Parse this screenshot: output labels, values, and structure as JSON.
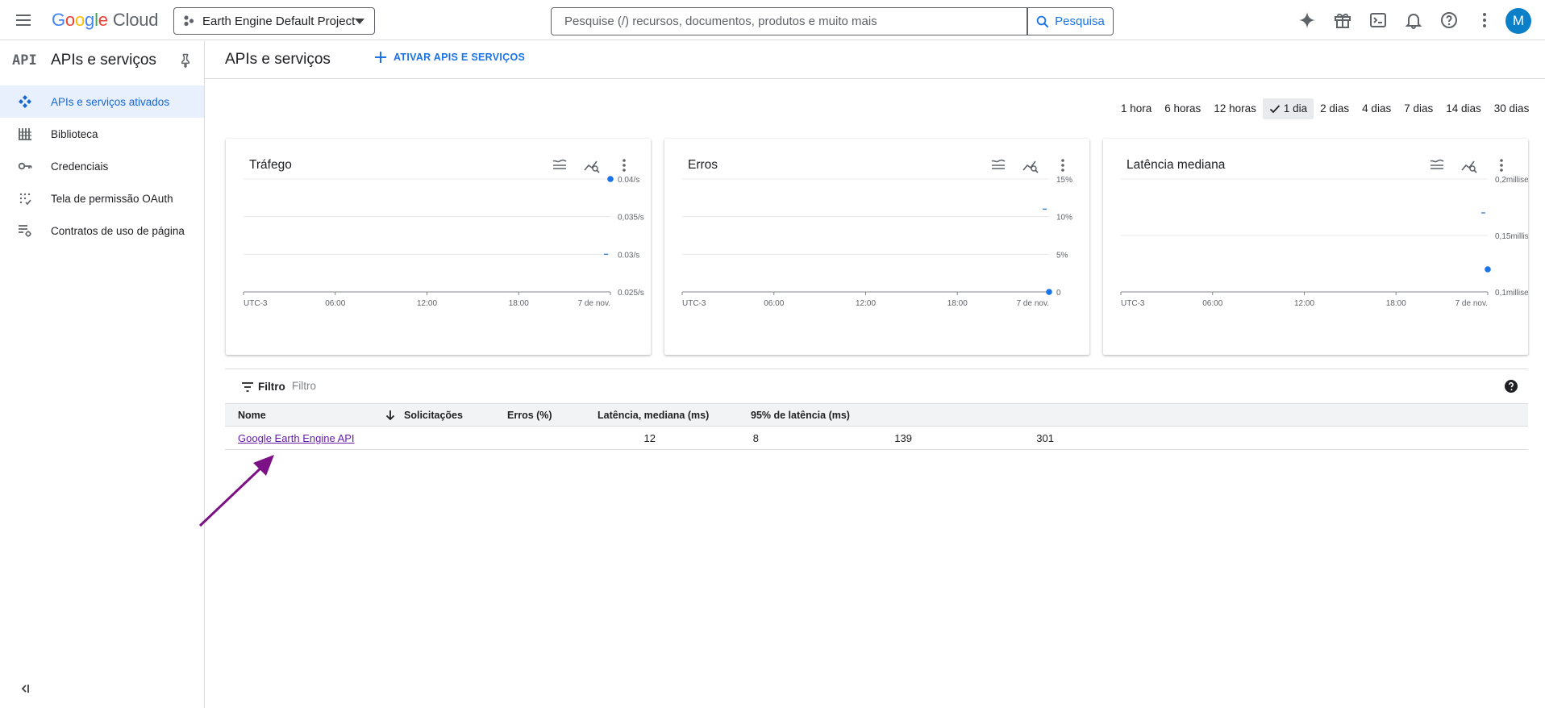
{
  "topbar": {
    "logo_google": [
      "G",
      "o",
      "o",
      "g",
      "l",
      "e"
    ],
    "logo_cloud": "Cloud",
    "project_name": "Earth Engine Default Project",
    "search_placeholder": "Pesquise (/) recursos, documentos, produtos e muito mais",
    "search_button": "Pesquisa",
    "avatar_initial": "M",
    "icons": [
      "menu-icon",
      "gemini-sparkle-icon",
      "gift-icon",
      "cloud-shell-icon",
      "notifications-icon",
      "help-icon",
      "more-vert-icon"
    ]
  },
  "sidebar": {
    "badge": "API",
    "title": "APIs e serviços",
    "items": [
      {
        "label": "APIs e serviços ativados",
        "icon": "api-dots-icon",
        "active": true
      },
      {
        "label": "Biblioteca",
        "icon": "library-icon",
        "active": false
      },
      {
        "label": "Credenciais",
        "icon": "key-icon",
        "active": false
      },
      {
        "label": "Tela de permissão OAuth",
        "icon": "oauth-consent-icon",
        "active": false
      },
      {
        "label": "Contratos de uso de página",
        "icon": "page-usage-icon",
        "active": false
      }
    ]
  },
  "main": {
    "title": "APIs e serviços",
    "enable_button": "ATIVAR APIS E SERVIÇOS"
  },
  "time_ranges": {
    "options": [
      "1 hora",
      "6 horas",
      "12 horas",
      "1 dia",
      "2 dias",
      "4 dias",
      "7 dias",
      "14 dias",
      "30 dias"
    ],
    "selected": "1 dia"
  },
  "cards": [
    {
      "title": "Tráfego"
    },
    {
      "title": "Erros"
    },
    {
      "title": "Latência mediana"
    }
  ],
  "chart_data": [
    {
      "type": "line",
      "title": "Tráfego",
      "x_ticks": [
        "UTC-3",
        "06:00",
        "12:00",
        "18:00",
        "7 de nov."
      ],
      "y_ticks": [
        "0.04/s",
        "0,035/s",
        "0.03/s",
        "0.025/s"
      ],
      "ylim": [
        0.025,
        0.04
      ],
      "series": [
        {
          "values": [
            {
              "x": "7 de nov.",
              "y": 0.04
            }
          ]
        }
      ],
      "dash_y": 0.03
    },
    {
      "type": "line",
      "title": "Erros",
      "x_ticks": [
        "UTC-3",
        "06:00",
        "12:00",
        "18:00",
        "7 de nov."
      ],
      "y_ticks": [
        "15%",
        "10%",
        "5%",
        "0"
      ],
      "ylim": [
        0,
        15
      ],
      "series": [
        {
          "values": [
            {
              "x": "7 de nov.",
              "y": 0
            }
          ]
        }
      ],
      "dash_y": 11
    },
    {
      "type": "line",
      "title": "Latência mediana",
      "x_ticks": [
        "UTC-3",
        "06:00",
        "12:00",
        "18:00",
        "7 de nov."
      ],
      "y_ticks": [
        "0,2milliseconds",
        "0,15milliseconds",
        "0,1milliseconds"
      ],
      "ylim": [
        0.1,
        0.2
      ],
      "series": [
        {
          "values": [
            {
              "x": "7 de nov.",
              "y": 0.12
            }
          ]
        }
      ],
      "dash_y": 0.17
    }
  ],
  "table": {
    "filter_label": "Filtro",
    "filter_placeholder": "Filtro",
    "columns": [
      "Nome",
      "Solicitações",
      "Erros (%)",
      "Latência, mediana (ms)",
      "95% de latência (ms)"
    ],
    "sort_column": "Solicitações",
    "rows": [
      {
        "name": "Google Earth Engine API",
        "requests": "12",
        "errors": "8",
        "latency_median": "139",
        "latency_95": "301"
      }
    ]
  },
  "colors": {
    "accent": "#1a73e8",
    "active_bg": "#e8f0fe",
    "link_visited": "#681da8",
    "annotation_arrow": "#7b1185",
    "data_point": "#1a73e8"
  }
}
